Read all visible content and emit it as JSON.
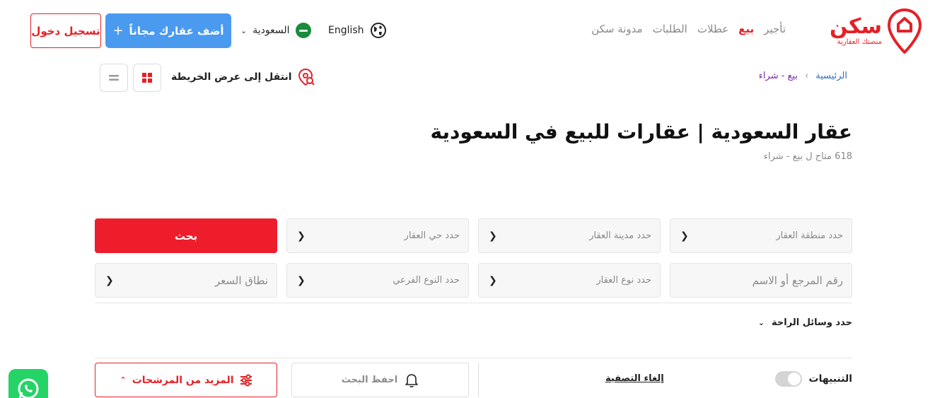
{
  "header": {
    "login_label": "تسجيل دخول",
    "add_property_label": "أضف عقارك مجاناً",
    "add_property_plus": "+",
    "country_label": "السعودية",
    "language_label": "English",
    "nav": [
      {
        "label": "تأجير",
        "active": false
      },
      {
        "label": "بيع",
        "active": true
      },
      {
        "label": "عطلات",
        "active": false
      },
      {
        "label": "الطلبات",
        "active": false
      },
      {
        "label": "مدونة سكن",
        "active": false
      }
    ],
    "logo_main": "سكن",
    "logo_sub": "منصتك العقارية"
  },
  "toolbar": {
    "map_view_label": "انتقل إلى عرض الخريطة"
  },
  "breadcrumb": {
    "home": "الرئيسية",
    "separator": "›",
    "current": "بيع - شراء"
  },
  "page": {
    "title": "عقار السعودية | عقارات للبيع في السعودية",
    "count_text": "618 متاح ل بيع - شراء"
  },
  "filters": {
    "region_placeholder": "حدد منطقة العقار",
    "city_placeholder": "حدد مدينة العقار",
    "district_placeholder": "حدد حي العقار",
    "search_label": "بحث",
    "ref_placeholder": "رقم المرجع أو الاسم",
    "type_placeholder": "حدد نوع العقار",
    "subtype_placeholder": "حدد النوع الفرعي",
    "price_placeholder": "نطاق السعر",
    "amenities_label": "حدد وسائل الراحة"
  },
  "actions": {
    "more_filters_label": "المزيد من المرشحات",
    "save_search_label": "احفظ البحث",
    "clear_filters_label": "إلغاء التصفية",
    "alerts_label": "التنبيهات",
    "alerts_on": false
  },
  "colors": {
    "brand_red": "#e62026",
    "add_blue": "#4a9af0",
    "whatsapp": "#25d366"
  }
}
